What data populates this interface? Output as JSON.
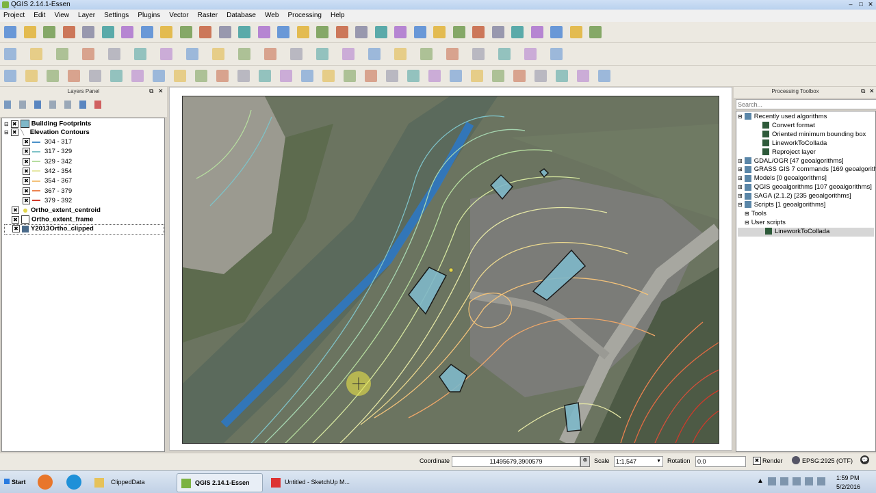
{
  "window": {
    "title": "QGIS 2.14.1-Essen",
    "controls": [
      "–",
      "□",
      "✕"
    ]
  },
  "menu": [
    "Project",
    "Edit",
    "View",
    "Layer",
    "Settings",
    "Plugins",
    "Vector",
    "Raster",
    "Database",
    "Web",
    "Processing",
    "Help"
  ],
  "toolbar_icons": {
    "row1": [
      "new-project-icon",
      "open-project-icon",
      "save-project-icon",
      "save-as-icon",
      "new-print-composer-icon",
      "composer-manager-icon",
      "pan-map-icon",
      "pan-icon",
      "pan-to-selection-icon",
      "zoom-in-icon",
      "zoom-out-icon",
      "zoom-native-icon",
      "zoom-full-icon",
      "zoom-to-layer-icon",
      "zoom-to-selection-icon",
      "zoom-last-icon",
      "zoom-next-icon",
      "refresh-icon",
      "identify-icon",
      "select-icon",
      "select-by-area-icon",
      "deselect-icon",
      "open-attribute-table-icon",
      "field-calculator-icon",
      "statistics-icon",
      "measure-icon",
      "map-tips-icon",
      "bookmark-icon",
      "new-bookmark-icon",
      "text-annotation-icon",
      "help-icon"
    ],
    "row2": [
      "edit-pencil-icon",
      "save-edits-icon",
      "add-feature-icon",
      "move-feature-icon",
      "delete-icon",
      "cut-icon",
      "copy-icon",
      "paste-icon",
      "label-icon",
      "pin-label-icon",
      "show-label-icon",
      "move-label-icon",
      "rotate-label-icon",
      "change-label-icon",
      "csw-icon",
      "python-icon",
      "digitize-icon",
      "node-tool-icon",
      "grass-tool-icon",
      "rotate-point-icon",
      "offset-icon",
      "processing-icon"
    ],
    "row3": [
      "simplify-icon",
      "add-ring-icon",
      "add-part-icon",
      "fill-ring-icon",
      "delete-ring-icon",
      "delete-part-icon",
      "reshape-icon",
      "offset-curve-icon",
      "split-features-icon",
      "split-parts-icon",
      "merge-features-icon",
      "merge-attributes-icon",
      "rotate-symbol-icon",
      "undo-icon",
      "redo-icon",
      "add-vector-icon",
      "add-raster-icon",
      "add-postgis-icon",
      "add-spatialite-icon",
      "add-mssql-icon",
      "add-oracle-icon",
      "add-wms-icon",
      "add-wcs-icon",
      "add-wfs-icon",
      "add-delimited-icon",
      "new-shapefile-icon",
      "new-spatialite-icon",
      "new-gpx-icon",
      "digitize-wms-icon"
    ]
  },
  "layers_panel": {
    "title": "Layers Panel",
    "layers": [
      {
        "name": "Building Footprints",
        "checked": "✖",
        "color": "#7fb8c9"
      },
      {
        "name": "Elevation Contours",
        "checked": "✖"
      },
      {
        "name": "Ortho_extent_centroid",
        "checked": "✖",
        "color": "#e3d64b"
      },
      {
        "name": "Ortho_extent_frame",
        "checked": "✖"
      },
      {
        "name": "Y2013Ortho_clipped",
        "checked": "✖"
      }
    ],
    "contour_classes": [
      {
        "label": "304 - 317",
        "color": "#4a90c8"
      },
      {
        "label": "317 - 329",
        "color": "#7ec2c7"
      },
      {
        "label": "329 - 342",
        "color": "#b6dd9f"
      },
      {
        "label": "342 - 354",
        "color": "#e6e8a6"
      },
      {
        "label": "354 - 367",
        "color": "#f3c27a"
      },
      {
        "label": "367 - 379",
        "color": "#ec8350"
      },
      {
        "label": "379 - 392",
        "color": "#cf3a2a"
      }
    ]
  },
  "processing_toolbox": {
    "title": "Processing Toolbox",
    "search_placeholder": "Search...",
    "items": [
      {
        "label": "Recently used algorithms",
        "level": 0,
        "expander": "⊟"
      },
      {
        "label": "Convert format",
        "level": 2
      },
      {
        "label": "Oriented minimum bounding box",
        "level": 2
      },
      {
        "label": "LineworkToCollada",
        "level": 2
      },
      {
        "label": "Reproject layer",
        "level": 2
      },
      {
        "label": "GDAL/OGR [47 geoalgorithms]",
        "level": 0,
        "expander": "⊞"
      },
      {
        "label": "GRASS GIS 7 commands [169 geoalgorith...",
        "level": 0,
        "expander": "⊞"
      },
      {
        "label": "Models [0 geoalgorithms]",
        "level": 0,
        "expander": "⊞"
      },
      {
        "label": "QGIS geoalgorithms [107 geoalgorithms]",
        "level": 0,
        "expander": "⊞"
      },
      {
        "label": "SAGA (2.1.2) [235 geoalgorithms]",
        "level": 0,
        "expander": "⊞"
      },
      {
        "label": "Scripts [1 geoalgorithms]",
        "level": 0,
        "expander": "⊟"
      },
      {
        "label": "Tools",
        "level": 1,
        "expander": "⊞"
      },
      {
        "label": "User scripts",
        "level": 1,
        "expander": "⊟"
      },
      {
        "label": "LineworkToCollada",
        "level": 3,
        "selected": true
      }
    ]
  },
  "statusbar": {
    "coordinate_label": "Coordinate",
    "coordinate_value": "11495679,3900579",
    "scale_label": "Scale",
    "scale_value": "1:1,547",
    "rotation_label": "Rotation",
    "rotation_value": "0.0",
    "render_label": "Render",
    "crs": "EPSG:2925 (OTF)"
  },
  "taskbar": {
    "start": "Start",
    "tasks": [
      {
        "label": "ClippedData"
      },
      {
        "label": "QGIS 2.14.1-Essen",
        "active": true
      },
      {
        "label": "Untitled - SketchUp M..."
      }
    ],
    "time": "1:59 PM",
    "date": "5/2/2016"
  }
}
